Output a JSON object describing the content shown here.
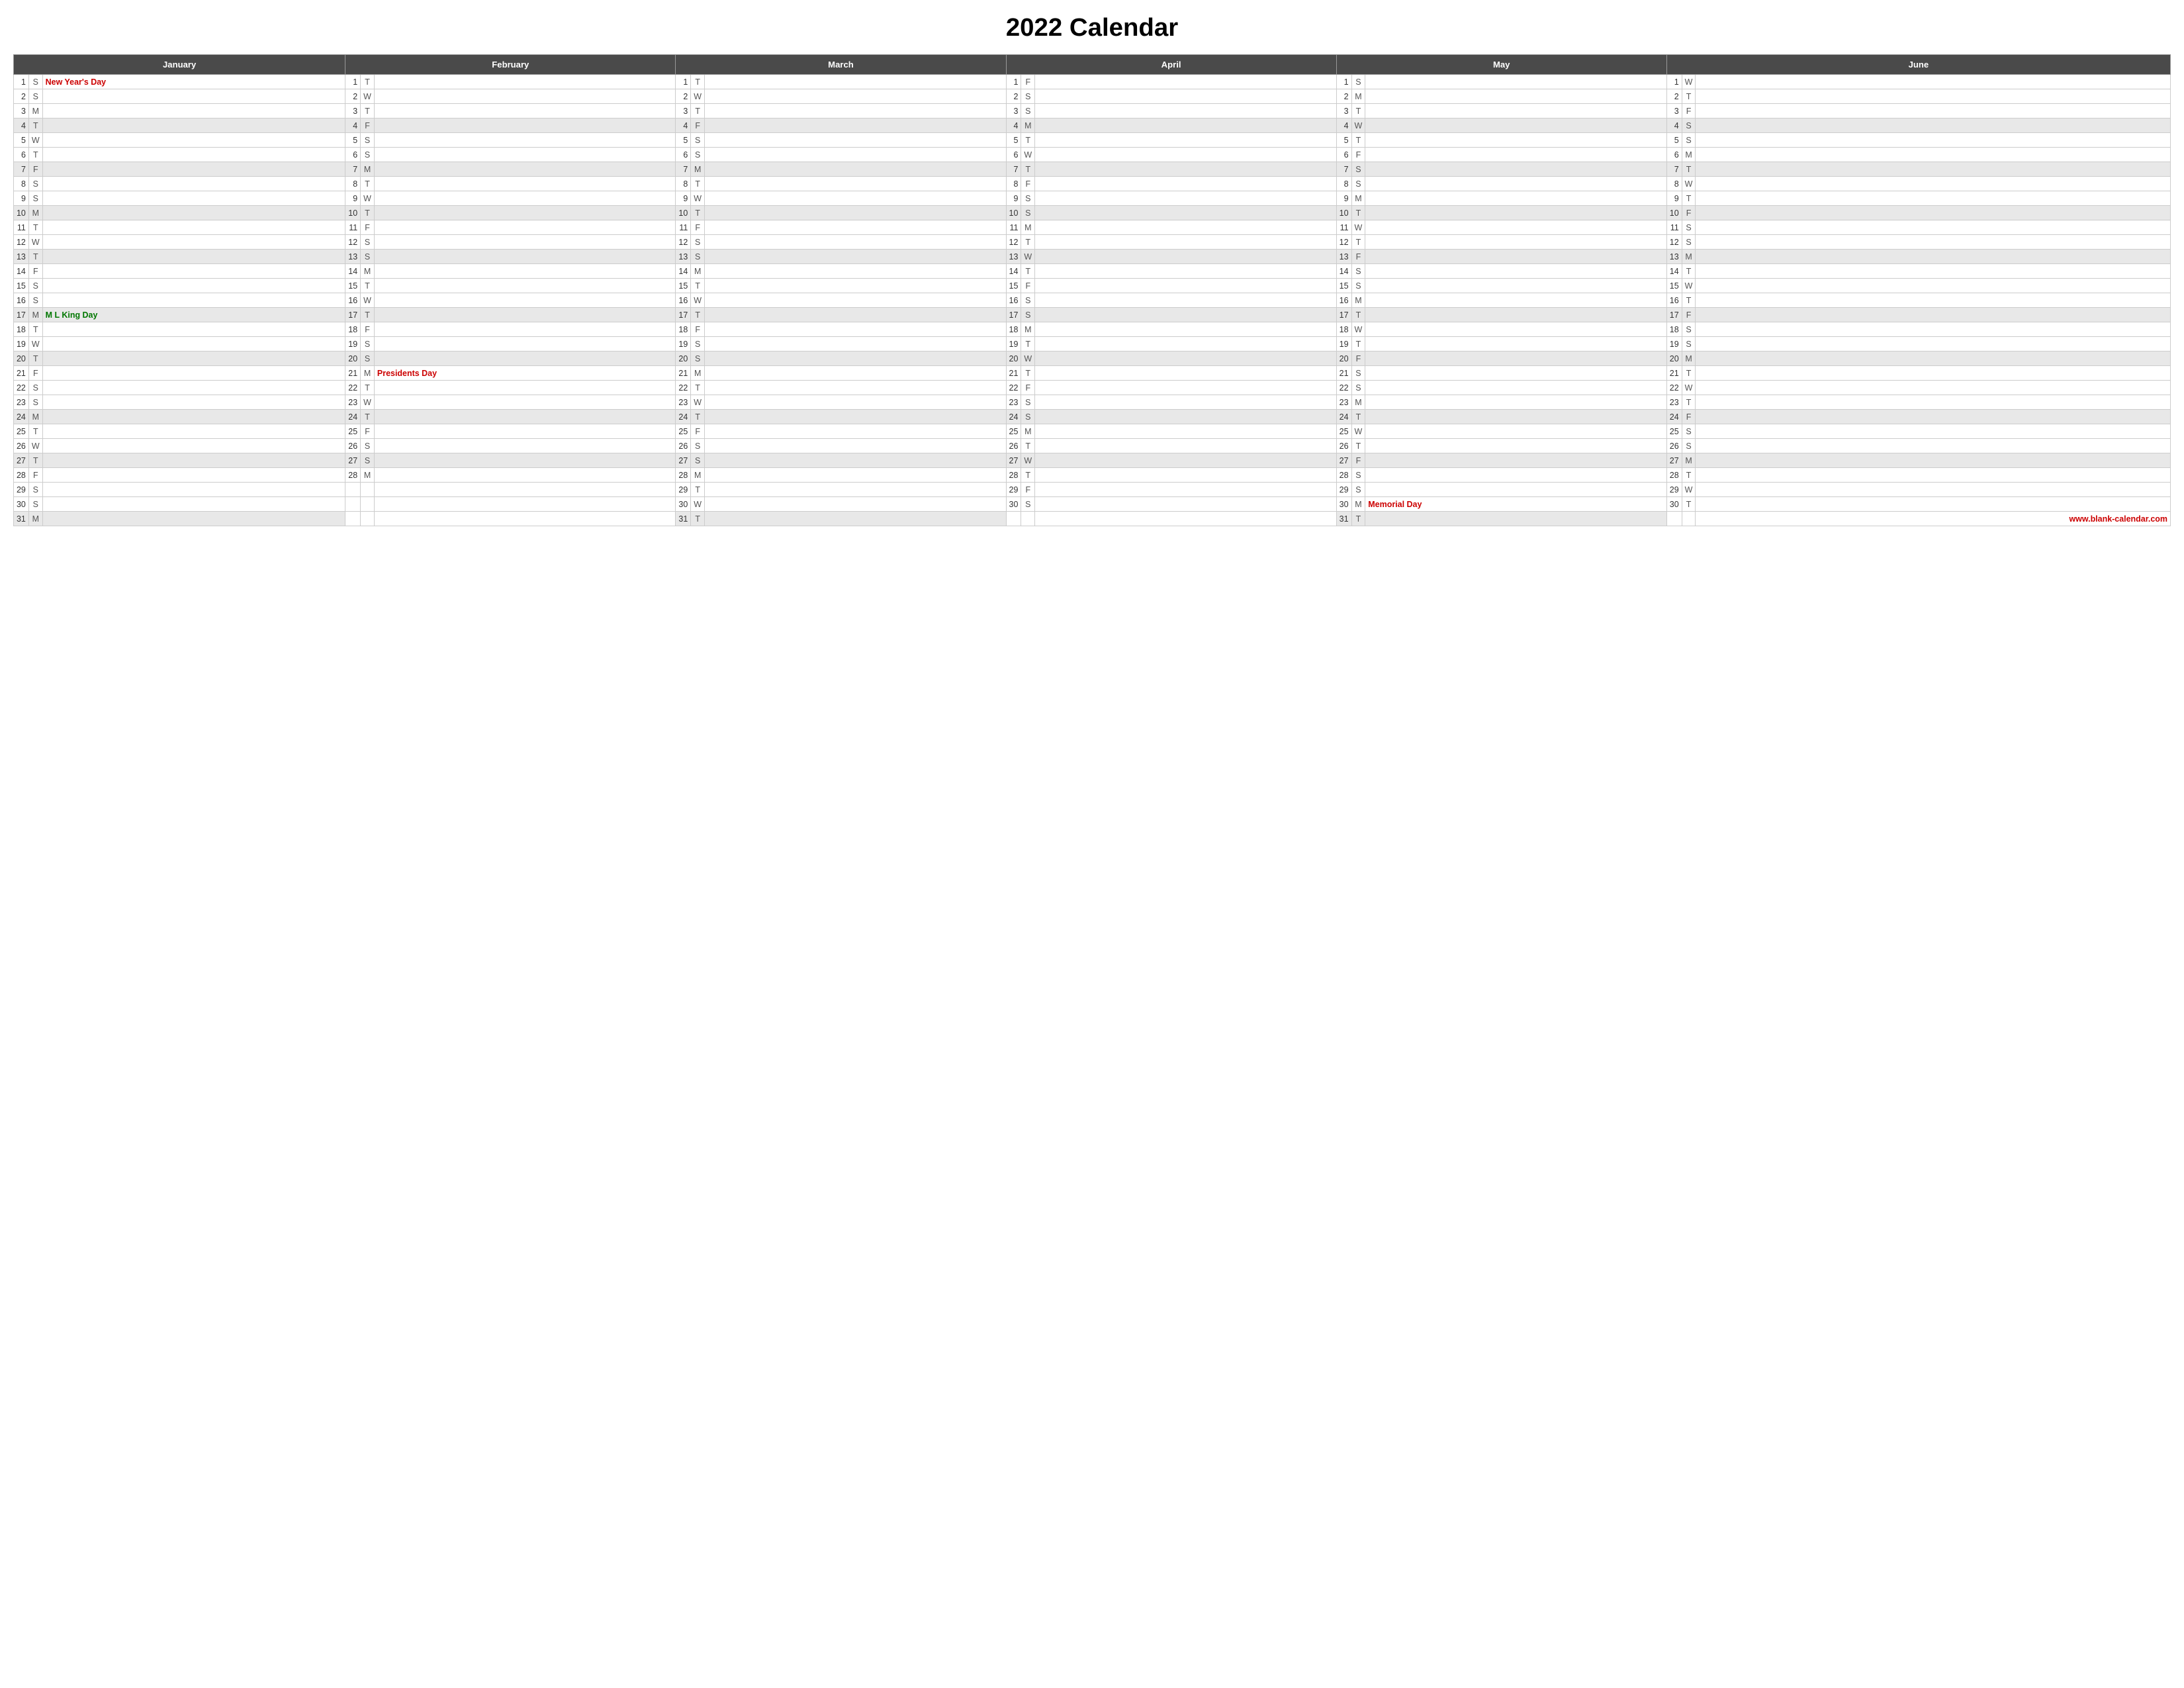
{
  "title": "2022 Calendar",
  "website": "www.blank-calendar.com",
  "months": [
    "January",
    "February",
    "March",
    "April",
    "May",
    "June"
  ],
  "rows": [
    {
      "jan": {
        "num": 1,
        "day": "S",
        "hol": "New Year's Day",
        "hol_class": "holiday-red",
        "shade": false
      },
      "feb": {
        "num": 1,
        "day": "T",
        "hol": "",
        "shade": false
      },
      "mar": {
        "num": 1,
        "day": "T",
        "hol": "",
        "shade": false
      },
      "apr": {
        "num": 1,
        "day": "F",
        "hol": "",
        "shade": false
      },
      "may": {
        "num": 1,
        "day": "S",
        "hol": "",
        "shade": false
      },
      "jun": {
        "num": 1,
        "day": "W",
        "hol": "",
        "shade": false
      }
    },
    {
      "jan": {
        "num": 2,
        "day": "S",
        "hol": "",
        "shade": false
      },
      "feb": {
        "num": 2,
        "day": "W",
        "hol": "",
        "shade": false
      },
      "mar": {
        "num": 2,
        "day": "W",
        "hol": "",
        "shade": false
      },
      "apr": {
        "num": 2,
        "day": "S",
        "hol": "",
        "shade": false
      },
      "may": {
        "num": 2,
        "day": "M",
        "hol": "",
        "shade": false
      },
      "jun": {
        "num": 2,
        "day": "T",
        "hol": "",
        "shade": false
      }
    },
    {
      "jan": {
        "num": 3,
        "day": "M",
        "hol": "",
        "shade": false
      },
      "feb": {
        "num": 3,
        "day": "T",
        "hol": "",
        "shade": false
      },
      "mar": {
        "num": 3,
        "day": "T",
        "hol": "",
        "shade": false
      },
      "apr": {
        "num": 3,
        "day": "S",
        "hol": "",
        "shade": false
      },
      "may": {
        "num": 3,
        "day": "T",
        "hol": "",
        "shade": false
      },
      "jun": {
        "num": 3,
        "day": "F",
        "hol": "",
        "shade": false
      }
    },
    {
      "jan": {
        "num": 4,
        "day": "T",
        "hol": "",
        "shade": true
      },
      "feb": {
        "num": 4,
        "day": "F",
        "hol": "",
        "shade": true
      },
      "mar": {
        "num": 4,
        "day": "F",
        "hol": "",
        "shade": true
      },
      "apr": {
        "num": 4,
        "day": "M",
        "hol": "",
        "shade": true
      },
      "may": {
        "num": 4,
        "day": "W",
        "hol": "",
        "shade": true
      },
      "jun": {
        "num": 4,
        "day": "S",
        "hol": "",
        "shade": true
      }
    },
    {
      "jan": {
        "num": 5,
        "day": "W",
        "hol": "",
        "shade": false
      },
      "feb": {
        "num": 5,
        "day": "S",
        "hol": "",
        "shade": false
      },
      "mar": {
        "num": 5,
        "day": "S",
        "hol": "",
        "shade": false
      },
      "apr": {
        "num": 5,
        "day": "T",
        "hol": "",
        "shade": false
      },
      "may": {
        "num": 5,
        "day": "T",
        "hol": "",
        "shade": false
      },
      "jun": {
        "num": 5,
        "day": "S",
        "hol": "",
        "shade": false
      }
    },
    {
      "jan": {
        "num": 6,
        "day": "T",
        "hol": "",
        "shade": false
      },
      "feb": {
        "num": 6,
        "day": "S",
        "hol": "",
        "shade": false
      },
      "mar": {
        "num": 6,
        "day": "S",
        "hol": "",
        "shade": false
      },
      "apr": {
        "num": 6,
        "day": "W",
        "hol": "",
        "shade": false
      },
      "may": {
        "num": 6,
        "day": "F",
        "hol": "",
        "shade": false
      },
      "jun": {
        "num": 6,
        "day": "M",
        "hol": "",
        "shade": false
      }
    },
    {
      "jan": {
        "num": 7,
        "day": "F",
        "hol": "",
        "shade": true
      },
      "feb": {
        "num": 7,
        "day": "M",
        "hol": "",
        "shade": true
      },
      "mar": {
        "num": 7,
        "day": "M",
        "hol": "",
        "shade": true
      },
      "apr": {
        "num": 7,
        "day": "T",
        "hol": "",
        "shade": true
      },
      "may": {
        "num": 7,
        "day": "S",
        "hol": "",
        "shade": true
      },
      "jun": {
        "num": 7,
        "day": "T",
        "hol": "",
        "shade": true
      }
    },
    {
      "jan": {
        "num": 8,
        "day": "S",
        "hol": "",
        "shade": false
      },
      "feb": {
        "num": 8,
        "day": "T",
        "hol": "",
        "shade": false
      },
      "mar": {
        "num": 8,
        "day": "T",
        "hol": "",
        "shade": false
      },
      "apr": {
        "num": 8,
        "day": "F",
        "hol": "",
        "shade": false
      },
      "may": {
        "num": 8,
        "day": "S",
        "hol": "",
        "shade": false
      },
      "jun": {
        "num": 8,
        "day": "W",
        "hol": "",
        "shade": false
      }
    },
    {
      "jan": {
        "num": 9,
        "day": "S",
        "hol": "",
        "shade": false
      },
      "feb": {
        "num": 9,
        "day": "W",
        "hol": "",
        "shade": false
      },
      "mar": {
        "num": 9,
        "day": "W",
        "hol": "",
        "shade": false
      },
      "apr": {
        "num": 9,
        "day": "S",
        "hol": "",
        "shade": false
      },
      "may": {
        "num": 9,
        "day": "M",
        "hol": "",
        "shade": false
      },
      "jun": {
        "num": 9,
        "day": "T",
        "hol": "",
        "shade": false
      }
    },
    {
      "jan": {
        "num": 10,
        "day": "M",
        "hol": "",
        "shade": true
      },
      "feb": {
        "num": 10,
        "day": "T",
        "hol": "",
        "shade": true
      },
      "mar": {
        "num": 10,
        "day": "T",
        "hol": "",
        "shade": true
      },
      "apr": {
        "num": 10,
        "day": "S",
        "hol": "",
        "shade": true
      },
      "may": {
        "num": 10,
        "day": "T",
        "hol": "",
        "shade": true
      },
      "jun": {
        "num": 10,
        "day": "F",
        "hol": "",
        "shade": true
      }
    },
    {
      "jan": {
        "num": 11,
        "day": "T",
        "hol": "",
        "shade": false
      },
      "feb": {
        "num": 11,
        "day": "F",
        "hol": "",
        "shade": false
      },
      "mar": {
        "num": 11,
        "day": "F",
        "hol": "",
        "shade": false
      },
      "apr": {
        "num": 11,
        "day": "M",
        "hol": "",
        "shade": false
      },
      "may": {
        "num": 11,
        "day": "W",
        "hol": "",
        "shade": false
      },
      "jun": {
        "num": 11,
        "day": "S",
        "hol": "",
        "shade": false
      }
    },
    {
      "jan": {
        "num": 12,
        "day": "W",
        "hol": "",
        "shade": false
      },
      "feb": {
        "num": 12,
        "day": "S",
        "hol": "",
        "shade": false
      },
      "mar": {
        "num": 12,
        "day": "S",
        "hol": "",
        "shade": false
      },
      "apr": {
        "num": 12,
        "day": "T",
        "hol": "",
        "shade": false
      },
      "may": {
        "num": 12,
        "day": "T",
        "hol": "",
        "shade": false
      },
      "jun": {
        "num": 12,
        "day": "S",
        "hol": "",
        "shade": false
      }
    },
    {
      "jan": {
        "num": 13,
        "day": "T",
        "hol": "",
        "shade": true
      },
      "feb": {
        "num": 13,
        "day": "S",
        "hol": "",
        "shade": true
      },
      "mar": {
        "num": 13,
        "day": "S",
        "hol": "",
        "shade": true
      },
      "apr": {
        "num": 13,
        "day": "W",
        "hol": "",
        "shade": true
      },
      "may": {
        "num": 13,
        "day": "F",
        "hol": "",
        "shade": true
      },
      "jun": {
        "num": 13,
        "day": "M",
        "hol": "",
        "shade": true
      }
    },
    {
      "jan": {
        "num": 14,
        "day": "F",
        "hol": "",
        "shade": false
      },
      "feb": {
        "num": 14,
        "day": "M",
        "hol": "",
        "shade": false
      },
      "mar": {
        "num": 14,
        "day": "M",
        "hol": "",
        "shade": false
      },
      "apr": {
        "num": 14,
        "day": "T",
        "hol": "",
        "shade": false
      },
      "may": {
        "num": 14,
        "day": "S",
        "hol": "",
        "shade": false
      },
      "jun": {
        "num": 14,
        "day": "T",
        "hol": "",
        "shade": false
      }
    },
    {
      "jan": {
        "num": 15,
        "day": "S",
        "hol": "",
        "shade": false
      },
      "feb": {
        "num": 15,
        "day": "T",
        "hol": "",
        "shade": false
      },
      "mar": {
        "num": 15,
        "day": "T",
        "hol": "",
        "shade": false
      },
      "apr": {
        "num": 15,
        "day": "F",
        "hol": "",
        "shade": false
      },
      "may": {
        "num": 15,
        "day": "S",
        "hol": "",
        "shade": false
      },
      "jun": {
        "num": 15,
        "day": "W",
        "hol": "",
        "shade": false
      }
    },
    {
      "jan": {
        "num": 16,
        "day": "S",
        "hol": "",
        "shade": false
      },
      "feb": {
        "num": 16,
        "day": "W",
        "hol": "",
        "shade": false
      },
      "mar": {
        "num": 16,
        "day": "W",
        "hol": "",
        "shade": false
      },
      "apr": {
        "num": 16,
        "day": "S",
        "hol": "",
        "shade": false
      },
      "may": {
        "num": 16,
        "day": "M",
        "hol": "",
        "shade": false
      },
      "jun": {
        "num": 16,
        "day": "T",
        "hol": "",
        "shade": false
      }
    },
    {
      "jan": {
        "num": 17,
        "day": "M",
        "hol": "M L King Day",
        "hol_class": "holiday-green",
        "shade": true
      },
      "feb": {
        "num": 17,
        "day": "T",
        "hol": "",
        "shade": true
      },
      "mar": {
        "num": 17,
        "day": "T",
        "hol": "",
        "shade": true
      },
      "apr": {
        "num": 17,
        "day": "S",
        "hol": "",
        "shade": true
      },
      "may": {
        "num": 17,
        "day": "T",
        "hol": "",
        "shade": true
      },
      "jun": {
        "num": 17,
        "day": "F",
        "hol": "",
        "shade": true
      }
    },
    {
      "jan": {
        "num": 18,
        "day": "T",
        "hol": "",
        "shade": false
      },
      "feb": {
        "num": 18,
        "day": "F",
        "hol": "",
        "shade": false
      },
      "mar": {
        "num": 18,
        "day": "F",
        "hol": "",
        "shade": false
      },
      "apr": {
        "num": 18,
        "day": "M",
        "hol": "",
        "shade": false
      },
      "may": {
        "num": 18,
        "day": "W",
        "hol": "",
        "shade": false
      },
      "jun": {
        "num": 18,
        "day": "S",
        "hol": "",
        "shade": false
      }
    },
    {
      "jan": {
        "num": 19,
        "day": "W",
        "hol": "",
        "shade": false
      },
      "feb": {
        "num": 19,
        "day": "S",
        "hol": "",
        "shade": false
      },
      "mar": {
        "num": 19,
        "day": "S",
        "hol": "",
        "shade": false
      },
      "apr": {
        "num": 19,
        "day": "T",
        "hol": "",
        "shade": false
      },
      "may": {
        "num": 19,
        "day": "T",
        "hol": "",
        "shade": false
      },
      "jun": {
        "num": 19,
        "day": "S",
        "hol": "",
        "shade": false
      }
    },
    {
      "jan": {
        "num": 20,
        "day": "T",
        "hol": "",
        "shade": true
      },
      "feb": {
        "num": 20,
        "day": "S",
        "hol": "",
        "shade": true
      },
      "mar": {
        "num": 20,
        "day": "S",
        "hol": "",
        "shade": true
      },
      "apr": {
        "num": 20,
        "day": "W",
        "hol": "",
        "shade": true
      },
      "may": {
        "num": 20,
        "day": "F",
        "hol": "",
        "shade": true
      },
      "jun": {
        "num": 20,
        "day": "M",
        "hol": "",
        "shade": true
      }
    },
    {
      "jan": {
        "num": 21,
        "day": "F",
        "hol": "",
        "shade": false
      },
      "feb": {
        "num": 21,
        "day": "M",
        "hol": "Presidents Day",
        "hol_class": "holiday-red",
        "shade": false
      },
      "mar": {
        "num": 21,
        "day": "M",
        "hol": "",
        "shade": false
      },
      "apr": {
        "num": 21,
        "day": "T",
        "hol": "",
        "shade": false
      },
      "may": {
        "num": 21,
        "day": "S",
        "hol": "",
        "shade": false
      },
      "jun": {
        "num": 21,
        "day": "T",
        "hol": "",
        "shade": false
      }
    },
    {
      "jan": {
        "num": 22,
        "day": "S",
        "hol": "",
        "shade": false
      },
      "feb": {
        "num": 22,
        "day": "T",
        "hol": "",
        "shade": false
      },
      "mar": {
        "num": 22,
        "day": "T",
        "hol": "",
        "shade": false
      },
      "apr": {
        "num": 22,
        "day": "F",
        "hol": "",
        "shade": false
      },
      "may": {
        "num": 22,
        "day": "S",
        "hol": "",
        "shade": false
      },
      "jun": {
        "num": 22,
        "day": "W",
        "hol": "",
        "shade": false
      }
    },
    {
      "jan": {
        "num": 23,
        "day": "S",
        "hol": "",
        "shade": false
      },
      "feb": {
        "num": 23,
        "day": "W",
        "hol": "",
        "shade": false
      },
      "mar": {
        "num": 23,
        "day": "W",
        "hol": "",
        "shade": false
      },
      "apr": {
        "num": 23,
        "day": "S",
        "hol": "",
        "shade": false
      },
      "may": {
        "num": 23,
        "day": "M",
        "hol": "",
        "shade": false
      },
      "jun": {
        "num": 23,
        "day": "T",
        "hol": "",
        "shade": false
      }
    },
    {
      "jan": {
        "num": 24,
        "day": "M",
        "hol": "",
        "shade": true
      },
      "feb": {
        "num": 24,
        "day": "T",
        "hol": "",
        "shade": true
      },
      "mar": {
        "num": 24,
        "day": "T",
        "hol": "",
        "shade": true
      },
      "apr": {
        "num": 24,
        "day": "S",
        "hol": "",
        "shade": true
      },
      "may": {
        "num": 24,
        "day": "T",
        "hol": "",
        "shade": true
      },
      "jun": {
        "num": 24,
        "day": "F",
        "hol": "",
        "shade": true
      }
    },
    {
      "jan": {
        "num": 25,
        "day": "T",
        "hol": "",
        "shade": false
      },
      "feb": {
        "num": 25,
        "day": "F",
        "hol": "",
        "shade": false
      },
      "mar": {
        "num": 25,
        "day": "F",
        "hol": "",
        "shade": false
      },
      "apr": {
        "num": 25,
        "day": "M",
        "hol": "",
        "shade": false
      },
      "may": {
        "num": 25,
        "day": "W",
        "hol": "",
        "shade": false
      },
      "jun": {
        "num": 25,
        "day": "S",
        "hol": "",
        "shade": false
      }
    },
    {
      "jan": {
        "num": 26,
        "day": "W",
        "hol": "",
        "shade": false
      },
      "feb": {
        "num": 26,
        "day": "S",
        "hol": "",
        "shade": false
      },
      "mar": {
        "num": 26,
        "day": "S",
        "hol": "",
        "shade": false
      },
      "apr": {
        "num": 26,
        "day": "T",
        "hol": "",
        "shade": false
      },
      "may": {
        "num": 26,
        "day": "T",
        "hol": "",
        "shade": false
      },
      "jun": {
        "num": 26,
        "day": "S",
        "hol": "",
        "shade": false
      }
    },
    {
      "jan": {
        "num": 27,
        "day": "T",
        "hol": "",
        "shade": true
      },
      "feb": {
        "num": 27,
        "day": "S",
        "hol": "",
        "shade": true
      },
      "mar": {
        "num": 27,
        "day": "S",
        "hol": "",
        "shade": true
      },
      "apr": {
        "num": 27,
        "day": "W",
        "hol": "",
        "shade": true
      },
      "may": {
        "num": 27,
        "day": "F",
        "hol": "",
        "shade": true
      },
      "jun": {
        "num": 27,
        "day": "M",
        "hol": "",
        "shade": true
      }
    },
    {
      "jan": {
        "num": 28,
        "day": "F",
        "hol": "",
        "shade": false
      },
      "feb": {
        "num": 28,
        "day": "M",
        "hol": "",
        "shade": false
      },
      "mar": {
        "num": 28,
        "day": "M",
        "hol": "",
        "shade": false
      },
      "apr": {
        "num": 28,
        "day": "T",
        "hol": "",
        "shade": false
      },
      "may": {
        "num": 28,
        "day": "S",
        "hol": "",
        "shade": false
      },
      "jun": {
        "num": 28,
        "day": "T",
        "hol": "",
        "shade": false
      }
    },
    {
      "jan": {
        "num": 29,
        "day": "S",
        "hol": "",
        "shade": false
      },
      "feb": null,
      "mar": {
        "num": 29,
        "day": "T",
        "hol": "",
        "shade": false
      },
      "apr": {
        "num": 29,
        "day": "F",
        "hol": "",
        "shade": false
      },
      "may": {
        "num": 29,
        "day": "S",
        "hol": "",
        "shade": false
      },
      "jun": {
        "num": 29,
        "day": "W",
        "hol": "",
        "shade": false
      }
    },
    {
      "jan": {
        "num": 30,
        "day": "S",
        "hol": "",
        "shade": false
      },
      "feb": null,
      "mar": {
        "num": 30,
        "day": "W",
        "hol": "",
        "shade": false
      },
      "apr": {
        "num": 30,
        "day": "S",
        "hol": "",
        "shade": false
      },
      "may": {
        "num": 30,
        "day": "M",
        "hol": "Memorial Day",
        "hol_class": "holiday-red",
        "shade": false
      },
      "jun": {
        "num": 30,
        "day": "T",
        "hol": "",
        "shade": false
      }
    },
    {
      "jan": {
        "num": 31,
        "day": "M",
        "hol": "",
        "shade": true
      },
      "feb": null,
      "mar": {
        "num": 31,
        "day": "T",
        "hol": "",
        "shade": true
      },
      "apr": null,
      "may": {
        "num": 31,
        "day": "T",
        "hol": "",
        "shade": true
      },
      "jun": null,
      "website": true
    }
  ]
}
